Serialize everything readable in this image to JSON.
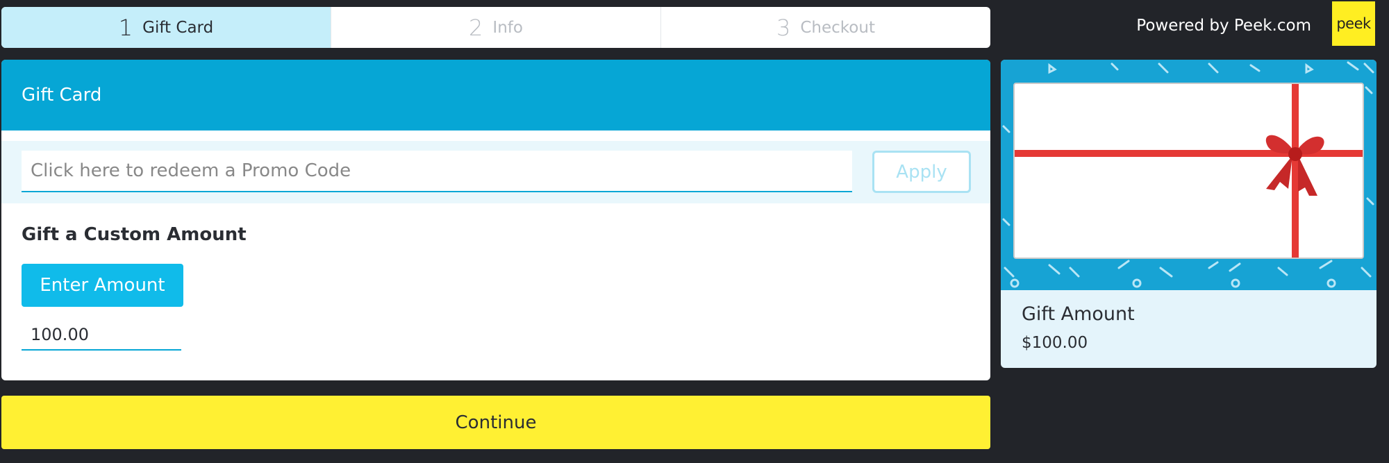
{
  "steps": [
    {
      "num": "1",
      "label": "Gift Card",
      "active": true
    },
    {
      "num": "2",
      "label": "Info",
      "active": false
    },
    {
      "num": "3",
      "label": "Checkout",
      "active": false
    }
  ],
  "branding": {
    "powered_by": "Powered by Peek.com",
    "logo_text": "peek"
  },
  "card": {
    "header": "Gift Card",
    "promo_placeholder": "Click here to redeem a Promo Code",
    "apply_label": "Apply",
    "custom_title": "Gift a Custom Amount",
    "enter_amount_label": "Enter Amount",
    "amount_value": "100.00"
  },
  "continue_label": "Continue",
  "summary": {
    "title": "Gift Amount",
    "price": "$100.00"
  },
  "colors": {
    "accent": "#06a6d5",
    "button": "#10bbea",
    "continue": "#fff033",
    "background": "#222429"
  }
}
